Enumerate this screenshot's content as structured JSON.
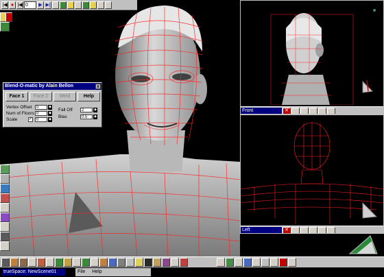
{
  "toolbar": {
    "buttons": [
      "|◀",
      "◀",
      "●",
      "|◀",
      "▶",
      "▶|"
    ],
    "frame_value": "0"
  },
  "dialog": {
    "title": "Blend-O-matic by Alain Bellon",
    "close_label": "x",
    "buttons": {
      "face1": "Face 1",
      "face2": "Face 2",
      "weld": "Weld",
      "help": "Help"
    },
    "fields": {
      "vertex_offset_label": "Vertex Offset",
      "vertex_offset_value": "0",
      "num_floors_label": "Num of Floors",
      "num_floors_value": "0",
      "scale_label": "Scale",
      "scale_checked": "✓",
      "scale_value": "0",
      "fall_off_label": "Fall Off",
      "fall_off_value": "2",
      "bias_label": "Bias",
      "bias_value": "0.5"
    }
  },
  "views": {
    "front_title": "Front",
    "left_title": "Left"
  },
  "statusbar": {
    "title": "trueSpace: NewScene01",
    "menu_file": "File",
    "menu_help": "Help"
  },
  "colors": {
    "wire": "#ff2020",
    "panel": "#c0c0c0",
    "titlebar": "#000080"
  }
}
